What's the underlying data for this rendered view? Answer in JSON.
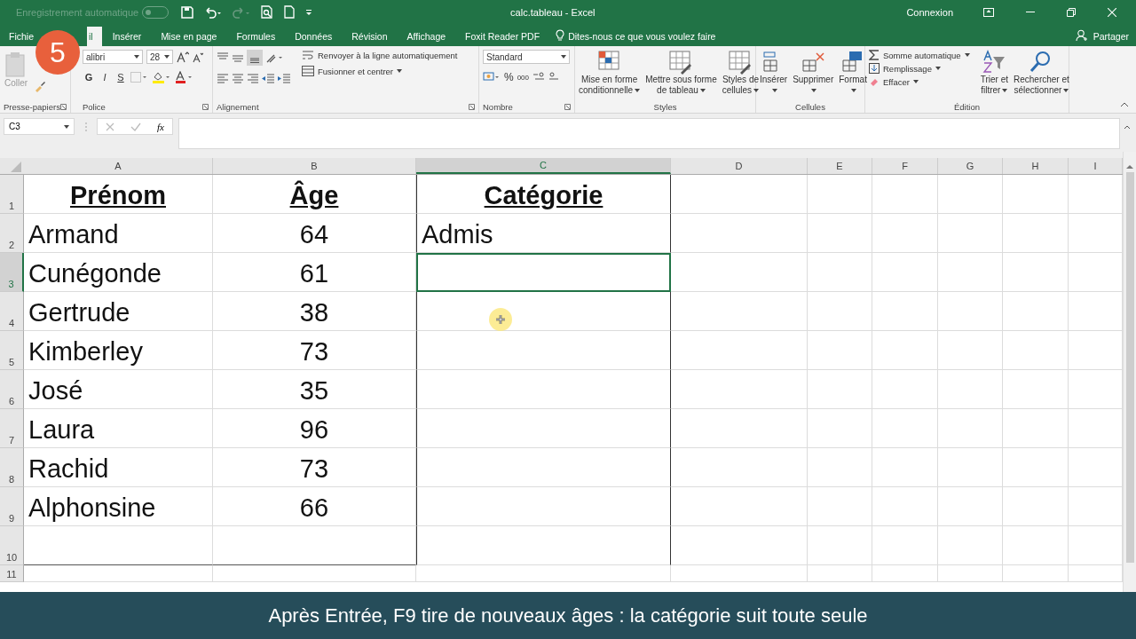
{
  "title_bar": {
    "autosave_label": "Enregistrement automatique",
    "autosave_on": false,
    "title": "calc.tableau  -  Excel",
    "sign_in": "Connexion"
  },
  "tabs": [
    {
      "label": "Fichie",
      "selected": false
    },
    {
      "label": "il",
      "selected": true
    },
    {
      "label": "Insérer",
      "selected": false
    },
    {
      "label": "Mise en page",
      "selected": false
    },
    {
      "label": "Formules",
      "selected": false
    },
    {
      "label": "Données",
      "selected": false
    },
    {
      "label": "Révision",
      "selected": false
    },
    {
      "label": "Affichage",
      "selected": false
    },
    {
      "label": "Foxit Reader PDF",
      "selected": false
    }
  ],
  "tell_me": "Dites-nous ce que vous voulez faire",
  "share": "Partager",
  "step_badge": "5",
  "ribbon": {
    "clipboard": {
      "paste": "Coller",
      "label": "Presse-papiers"
    },
    "font": {
      "name": "alibri",
      "size": "28",
      "bold": "G",
      "italic": "I",
      "underline": "S",
      "label": "Police"
    },
    "alignment": {
      "wrap": "Renvoyer à la ligne automatiquement",
      "merge": "Fusionner et centrer",
      "bottom_aligned": true,
      "label": "Alignement"
    },
    "number": {
      "format": "Standard",
      "percent": "%",
      "thousands": "000",
      "label": "Nombre"
    },
    "styles": {
      "buttons": [
        {
          "lines": [
            "Mise en forme",
            "conditionnelle"
          ]
        },
        {
          "lines": [
            "Mettre sous forme",
            "de tableau"
          ]
        },
        {
          "lines": [
            "Styles de",
            "cellules"
          ]
        }
      ],
      "label": "Styles"
    },
    "cells": {
      "buttons": [
        "Insérer",
        "Supprimer",
        "Format"
      ],
      "label": "Cellules"
    },
    "editing": {
      "autosum": "Somme automatique",
      "fill": "Remplissage",
      "clear": "Effacer",
      "buttons": [
        {
          "lines": [
            "Trier et",
            "filtrer"
          ]
        },
        {
          "lines": [
            "Rechercher et",
            "sélectionner"
          ]
        }
      ],
      "label": "Édition"
    }
  },
  "formula_bar": {
    "name_box": "C3",
    "fx": "fx"
  },
  "columns": [
    {
      "label": "A",
      "selected": false
    },
    {
      "label": "B",
      "selected": false
    },
    {
      "label": "C",
      "selected": true
    },
    {
      "label": "D",
      "selected": false
    },
    {
      "label": "E",
      "selected": false
    },
    {
      "label": "F",
      "selected": false
    },
    {
      "label": "G",
      "selected": false
    },
    {
      "label": "H",
      "selected": false
    },
    {
      "label": "I",
      "selected": false
    }
  ],
  "rows": [
    {
      "header": "1",
      "selected": false,
      "kind": "heading",
      "cells": [
        "Prénom",
        "Âge",
        "Catégorie"
      ]
    },
    {
      "header": "2",
      "selected": false,
      "kind": "data",
      "cells": [
        "Armand",
        "64",
        "Admis"
      ]
    },
    {
      "header": "3",
      "selected": true,
      "kind": "data",
      "cells": [
        "Cunégonde",
        "61"
      ]
    },
    {
      "header": "4",
      "selected": false,
      "kind": "data",
      "cells": [
        "Gertrude",
        "38"
      ]
    },
    {
      "header": "5",
      "selected": false,
      "kind": "data",
      "cells": [
        "Kimberley",
        "73"
      ]
    },
    {
      "header": "6",
      "selected": false,
      "kind": "data",
      "cells": [
        "José",
        "35"
      ]
    },
    {
      "header": "7",
      "selected": false,
      "kind": "data",
      "cells": [
        "Laura",
        "96"
      ]
    },
    {
      "header": "8",
      "selected": false,
      "kind": "data",
      "cells": [
        "Rachid",
        "73"
      ]
    },
    {
      "header": "9",
      "selected": false,
      "kind": "data",
      "cells": [
        "Alphonsine",
        "66"
      ]
    },
    {
      "header": "10",
      "selected": false,
      "kind": "data",
      "cells": []
    },
    {
      "header": "11",
      "selected": false,
      "kind": "small",
      "cells": []
    }
  ],
  "caption": "Après Entrée, F9 tire de nouveaux âges : la catégorie suit toute seule"
}
